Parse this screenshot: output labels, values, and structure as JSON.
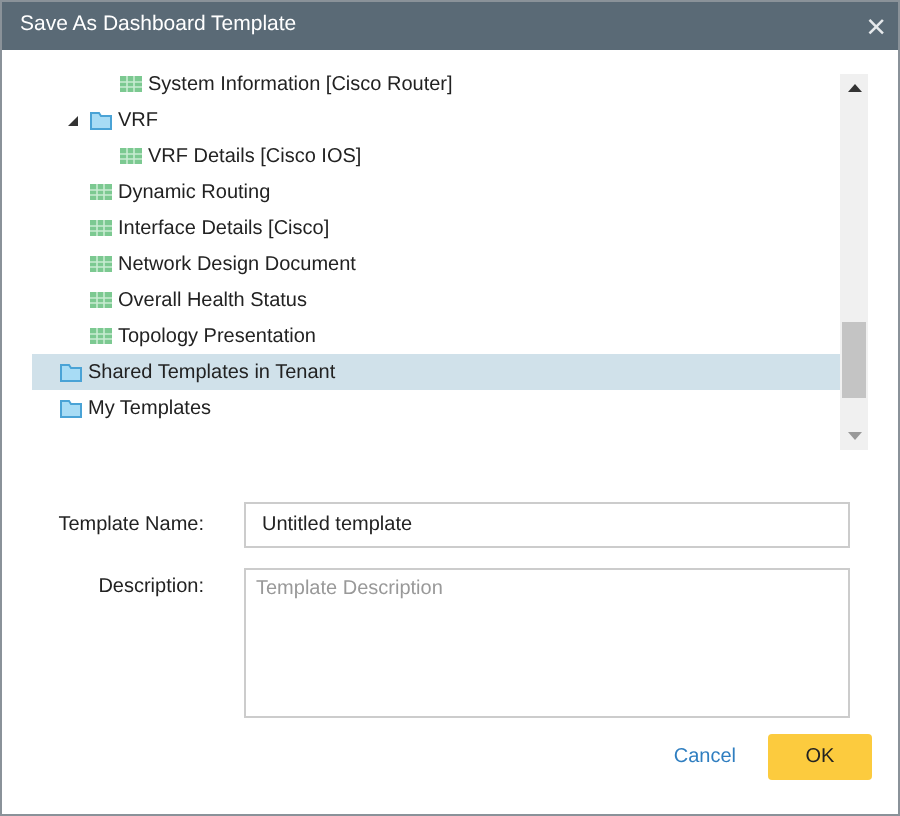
{
  "window": {
    "title": "Save As Dashboard Template",
    "close": "×"
  },
  "tree": [
    {
      "children": [
        {
          "children": [
            {
              "label": "System Information [Cisco Router]",
              "kind": "report",
              "selected": false
            }
          ]
        },
        {
          "label": "VRF",
          "kind": "folder",
          "expanded": true,
          "selected": false,
          "children": [
            {
              "label": "VRF Details [Cisco IOS]",
              "kind": "report",
              "selected": false
            }
          ]
        },
        {
          "label": "Dynamic Routing",
          "kind": "report",
          "selected": false
        },
        {
          "label": "Interface Details [Cisco]",
          "kind": "report",
          "selected": false
        },
        {
          "label": "Network Design Document",
          "kind": "report",
          "selected": false
        },
        {
          "label": "Overall Health Status",
          "kind": "report",
          "selected": false
        },
        {
          "label": "Topology Presentation",
          "kind": "report",
          "selected": false
        }
      ]
    },
    {
      "label": "Shared Templates in Tenant",
      "kind": "folder",
      "selected": true
    },
    {
      "label": "My Templates",
      "kind": "folder",
      "selected": false
    }
  ],
  "form": {
    "name_label": "Template Name:",
    "name_value": "Untitled template",
    "description_label": "Description:",
    "description_placeholder": "Template Description"
  },
  "buttons": {
    "cancel": "Cancel",
    "ok": "OK"
  }
}
